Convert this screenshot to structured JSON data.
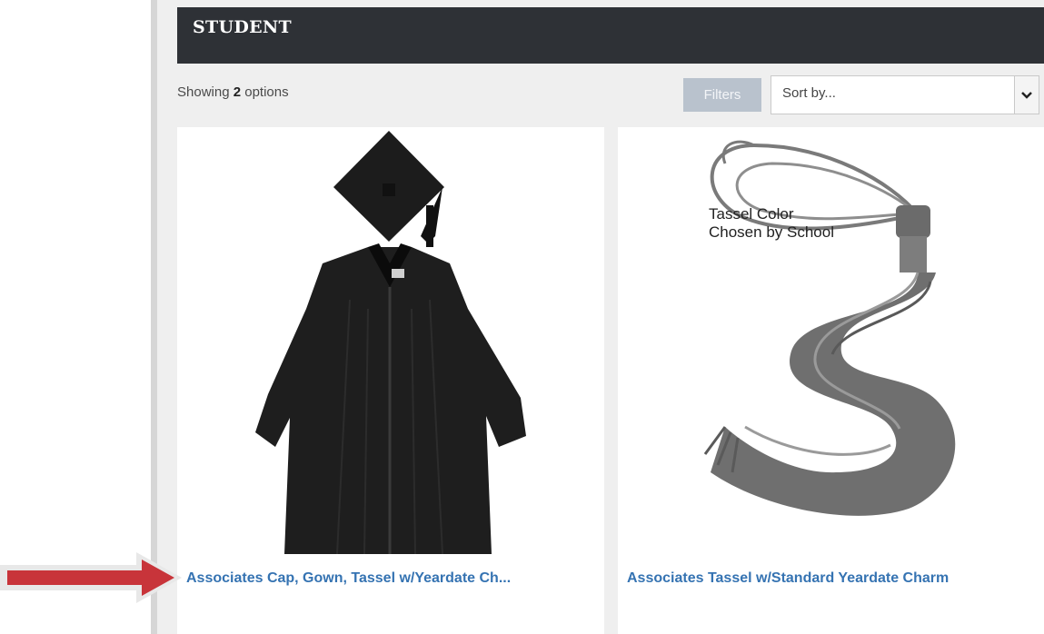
{
  "header": {
    "title": "STUDENT"
  },
  "toolbar": {
    "showing_prefix": "Showing ",
    "showing_count": "2",
    "showing_suffix": " options",
    "filters_label": "Filters",
    "sort_placeholder": "Sort by..."
  },
  "products": [
    {
      "title": "Associates Cap, Gown, Tassel w/Yeardate Ch..."
    },
    {
      "title": "Associates Tassel w/Standard Yeardate Charm",
      "image_note_line1": "Tassel Color",
      "image_note_line2": "Chosen by School"
    }
  ],
  "icons": {
    "sort": "chevron-down-icon",
    "pointer": "red-arrow-annotation"
  },
  "colors": {
    "header_bg": "#2e3136",
    "link": "#3573b2",
    "filters_bg": "#b9c2cd",
    "arrow": "#c8343a"
  }
}
